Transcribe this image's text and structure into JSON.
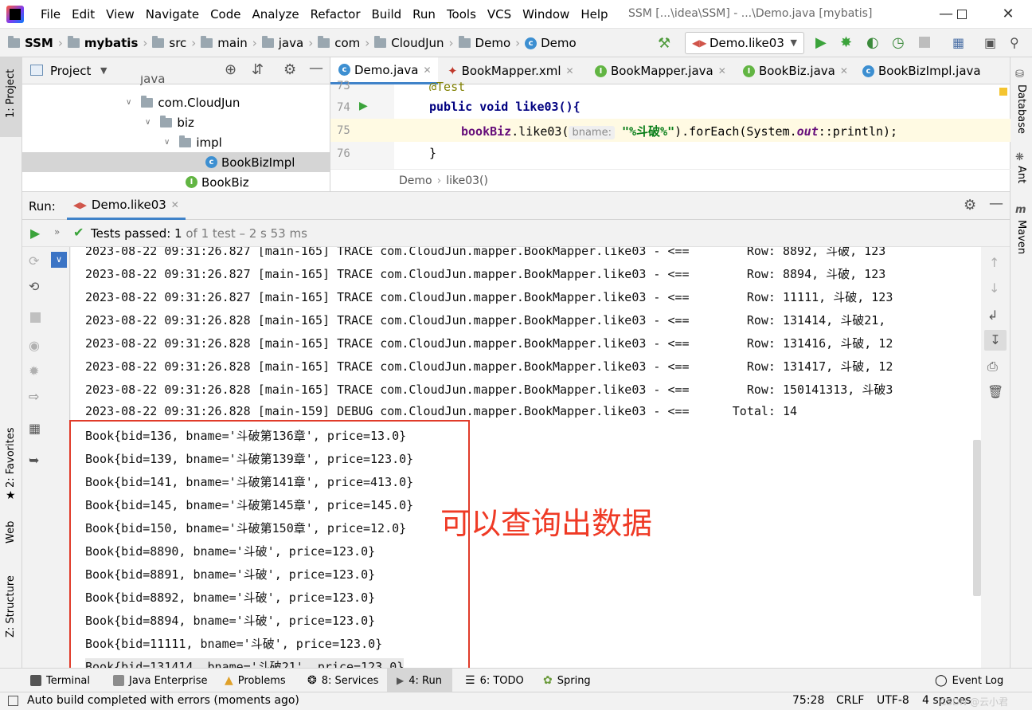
{
  "menu": [
    "File",
    "Edit",
    "View",
    "Navigate",
    "Code",
    "Analyze",
    "Refactor",
    "Build",
    "Run",
    "Tools",
    "VCS",
    "Window",
    "Help"
  ],
  "window_title": "SSM [...\\idea\\SSM] - ...\\Demo.java [mybatis]",
  "breadcrumbs": [
    "SSM",
    "mybatis",
    "src",
    "main",
    "java",
    "com",
    "CloudJun",
    "Demo",
    "Demo"
  ],
  "run_config": "Demo.like03",
  "project_panel": {
    "title": "Project",
    "items": [
      {
        "label": "java"
      },
      {
        "label": "com.CloudJun"
      },
      {
        "label": "biz"
      },
      {
        "label": "impl"
      },
      {
        "label": "BookBizImpl"
      },
      {
        "label": "BookBiz"
      }
    ]
  },
  "editor_tabs": [
    "Demo.java",
    "BookMapper.xml",
    "BookMapper.java",
    "BookBiz.java",
    "BookBizImpl.java"
  ],
  "code": {
    "lines": [
      {
        "num": "73",
        "text": "@Test"
      },
      {
        "num": "74",
        "text": "public void like03(){"
      },
      {
        "num": "75",
        "pre": "bookBiz",
        "mid": ".like03(",
        "hint": "bname:",
        "str": "\"%斗破%\"",
        "post": ").forEach(System.",
        "italic": "out",
        "end": "::println);"
      },
      {
        "num": "76",
        "text": "}"
      }
    ],
    "crumb": [
      "Demo",
      "like03()"
    ]
  },
  "run": {
    "label": "Run:",
    "tab": "Demo.like03",
    "status_bold": "Tests passed: 1",
    "status_rest": " of 1 test – 2 s 53 ms"
  },
  "console_lines": [
    "2023-08-22 09:31:26.827 [main-165] TRACE com.CloudJun.mapper.BookMapper.like03 - <==        Row: 8892, 斗破, 123",
    "2023-08-22 09:31:26.827 [main-165] TRACE com.CloudJun.mapper.BookMapper.like03 - <==        Row: 8894, 斗破, 123",
    "2023-08-22 09:31:26.827 [main-165] TRACE com.CloudJun.mapper.BookMapper.like03 - <==        Row: 11111, 斗破, 123",
    "2023-08-22 09:31:26.828 [main-165] TRACE com.CloudJun.mapper.BookMapper.like03 - <==        Row: 131414, 斗破21, ",
    "2023-08-22 09:31:26.828 [main-165] TRACE com.CloudJun.mapper.BookMapper.like03 - <==        Row: 131416, 斗破, 12",
    "2023-08-22 09:31:26.828 [main-165] TRACE com.CloudJun.mapper.BookMapper.like03 - <==        Row: 131417, 斗破, 12",
    "2023-08-22 09:31:26.828 [main-165] TRACE com.CloudJun.mapper.BookMapper.like03 - <==        Row: 150141313, 斗破3",
    "2023-08-22 09:31:26.828 [main-159] DEBUG com.CloudJun.mapper.BookMapper.like03 - <==      Total: 14",
    "Book{bid=136, bname='斗破第136章', price=13.0}",
    "Book{bid=139, bname='斗破第139章', price=123.0}",
    "Book{bid=141, bname='斗破第141章', price=413.0}",
    "Book{bid=145, bname='斗破第145章', price=145.0}",
    "Book{bid=150, bname='斗破第150章', price=12.0}",
    "Book{bid=8890, bname='斗破', price=123.0}",
    "Book{bid=8891, bname='斗破', price=123.0}",
    "Book{bid=8892, bname='斗破', price=123.0}",
    "Book{bid=8894, bname='斗破', price=123.0}",
    "Book{bid=11111, bname='斗破', price=123.0}",
    "Book{bid=131414, bname='斗破21', price=123.0}"
  ],
  "annotation": "可以查询出数据",
  "left_strip": [
    "1: Project",
    "2: Favorites",
    "Web",
    "Z: Structure"
  ],
  "right_strip": [
    "Database",
    "Ant",
    "Maven"
  ],
  "bottom_tabs": [
    "Terminal",
    "Java Enterprise",
    "Problems",
    "8: Services",
    "4: Run",
    "6: TODO",
    "Spring"
  ],
  "event_log": "Event Log",
  "status": {
    "message": "Auto build completed with errors (moments ago)",
    "position": "75:28",
    "line_sep": "CRLF",
    "encoding": "UTF-8",
    "indent": "4 spaces",
    "watermark": "CSDN @云小君"
  }
}
